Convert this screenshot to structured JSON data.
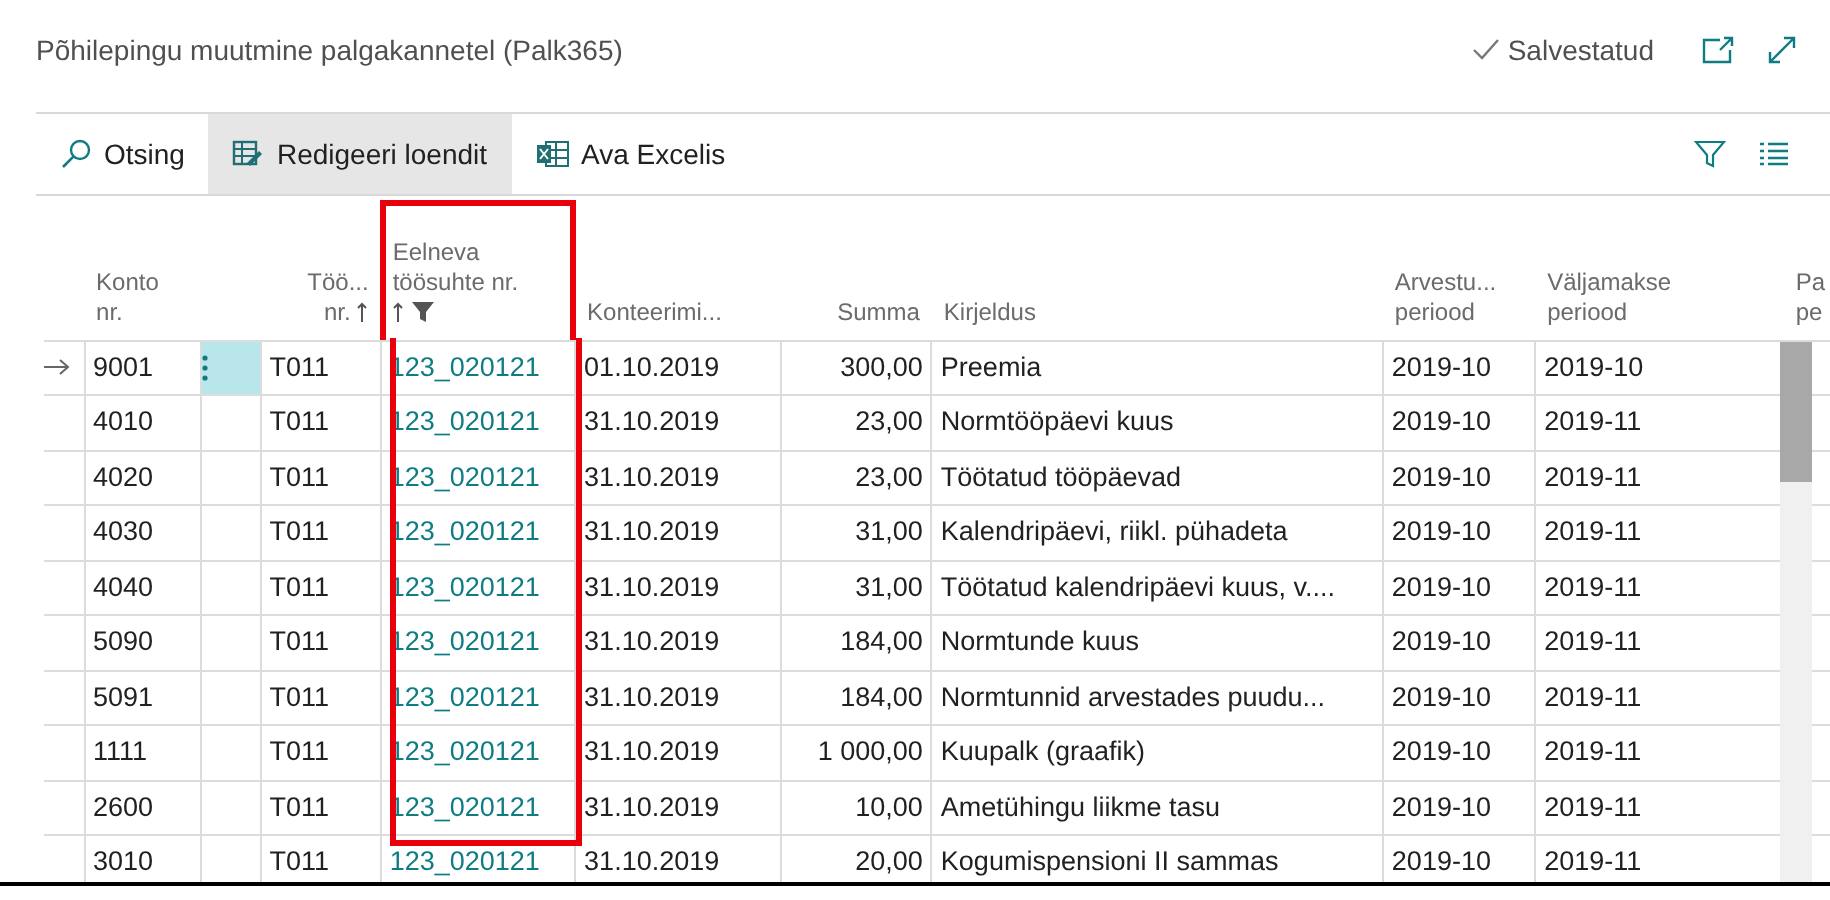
{
  "page": {
    "title": "Põhilepingu muutmine palgakannetel (Palk365)",
    "status": "Salvestatud"
  },
  "toolbar": [
    {
      "label": "Otsing",
      "kind": "search",
      "selected": false
    },
    {
      "label": "Redigeeri loendit",
      "kind": "edit",
      "selected": true
    },
    {
      "label": "Ava Excelis",
      "kind": "excel",
      "selected": false
    }
  ],
  "table": {
    "columns": [
      {
        "label": [
          "Konto",
          "nr."
        ],
        "kind": "text",
        "sorted": false,
        "filtered": false,
        "highlighted": false
      },
      {
        "label": [
          "Töö...",
          "nr."
        ],
        "kind": "code",
        "sorted": true,
        "filtered": false,
        "highlighted": false
      },
      {
        "label": [
          "Eelneva",
          "töösuhte nr."
        ],
        "kind": "link",
        "sorted": true,
        "filtered": true,
        "highlighted": true
      },
      {
        "label": [
          "Konteerimi..."
        ],
        "kind": "text",
        "sorted": false,
        "filtered": false,
        "highlighted": false
      },
      {
        "label": [
          "Summa"
        ],
        "kind": "number",
        "sorted": false,
        "filtered": false,
        "highlighted": false
      },
      {
        "label": [
          "Kirjeldus"
        ],
        "kind": "text",
        "sorted": false,
        "filtered": false,
        "highlighted": false
      },
      {
        "label": [
          "Arvestu...",
          "periood"
        ],
        "kind": "text",
        "sorted": false,
        "filtered": false,
        "highlighted": false
      },
      {
        "label": [
          "Väljamakse",
          "periood"
        ],
        "kind": "text",
        "sorted": false,
        "filtered": false,
        "highlighted": false
      },
      {
        "label": [
          "Pa",
          "pe"
        ],
        "kind": "text",
        "sorted": false,
        "filtered": false,
        "highlighted": false
      }
    ],
    "rows": [
      {
        "selected": true,
        "cells": [
          "9001",
          "T011",
          "123_020121",
          "01.10.2019",
          "300,00",
          "Preemia",
          "2019-10",
          "2019-10"
        ]
      },
      {
        "selected": false,
        "cells": [
          "4010",
          "T011",
          "123_020121",
          "31.10.2019",
          "23,00",
          "Normtööpäevi kuus",
          "2019-10",
          "2019-11"
        ]
      },
      {
        "selected": false,
        "cells": [
          "4020",
          "T011",
          "123_020121",
          "31.10.2019",
          "23,00",
          "Töötatud tööpäevad",
          "2019-10",
          "2019-11"
        ]
      },
      {
        "selected": false,
        "cells": [
          "4030",
          "T011",
          "123_020121",
          "31.10.2019",
          "31,00",
          "Kalendripäevi, riikl. pühadeta",
          "2019-10",
          "2019-11"
        ]
      },
      {
        "selected": false,
        "cells": [
          "4040",
          "T011",
          "123_020121",
          "31.10.2019",
          "31,00",
          "Töötatud kalendripäevi kuus, v....",
          "2019-10",
          "2019-11"
        ]
      },
      {
        "selected": false,
        "cells": [
          "5090",
          "T011",
          "123_020121",
          "31.10.2019",
          "184,00",
          "Normtunde kuus",
          "2019-10",
          "2019-11"
        ]
      },
      {
        "selected": false,
        "cells": [
          "5091",
          "T011",
          "123_020121",
          "31.10.2019",
          "184,00",
          "Normtunnid arvestades puudu...",
          "2019-10",
          "2019-11"
        ]
      },
      {
        "selected": false,
        "cells": [
          "1111",
          "T011",
          "123_020121",
          "31.10.2019",
          "1 000,00",
          "Kuupalk (graafik)",
          "2019-10",
          "2019-11"
        ]
      },
      {
        "selected": false,
        "cells": [
          "2600",
          "T011",
          "123_020121",
          "31.10.2019",
          "10,00",
          "Ametühingu liikme tasu",
          "2019-10",
          "2019-11"
        ]
      },
      {
        "selected": false,
        "cells": [
          "3010",
          "T011",
          "123_020121",
          "31.10.2019",
          "20,00",
          "Kogumispensioni II sammas",
          "2019-10",
          "2019-11"
        ]
      }
    ]
  }
}
